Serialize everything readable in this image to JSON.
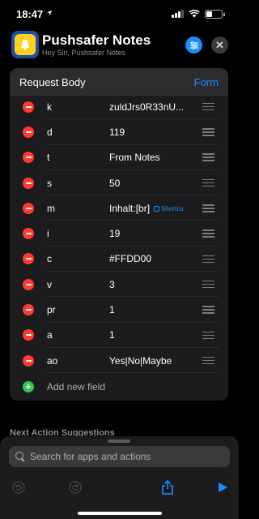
{
  "status_bar": {
    "time": "18:47"
  },
  "header": {
    "app_title": "Pushsafer Notes",
    "app_subtitle": "Hey Siri, Pushsafer Notes",
    "icons": {
      "app": "bell-icon",
      "settings": "sliders-icon",
      "close": "close-icon"
    },
    "close_glyph": "✕"
  },
  "card": {
    "title": "Request Body",
    "mode": "Form",
    "rows": [
      {
        "key": "k",
        "value": "zuldJrs0R33nU..."
      },
      {
        "key": "d",
        "value": "119"
      },
      {
        "key": "t",
        "value": "From Notes"
      },
      {
        "key": "s",
        "value": "50"
      },
      {
        "key": "m",
        "value": "Inhalt:[br]",
        "chip": "Shortcu"
      },
      {
        "key": "i",
        "value": "19"
      },
      {
        "key": "c",
        "value": "#FFDD00"
      },
      {
        "key": "v",
        "value": "3"
      },
      {
        "key": "pr",
        "value": "1"
      },
      {
        "key": "a",
        "value": "1"
      },
      {
        "key": "ao",
        "value": "Yes|No|Maybe"
      }
    ],
    "add_label": "Add new field",
    "plus_glyph": "+"
  },
  "next_section_label": "Next Action Suggestions",
  "search": {
    "placeholder": "Search for apps and actions"
  },
  "toolbar": {
    "icons": [
      "undo-icon",
      "redo-icon",
      "share-icon",
      "play-icon"
    ]
  },
  "colors": {
    "accent": "#1a8cff",
    "delete": "#ff3b30",
    "add": "#34c759",
    "app_icon_bg": "#1e4fa8",
    "app_icon_fg": "#ffd21e"
  }
}
